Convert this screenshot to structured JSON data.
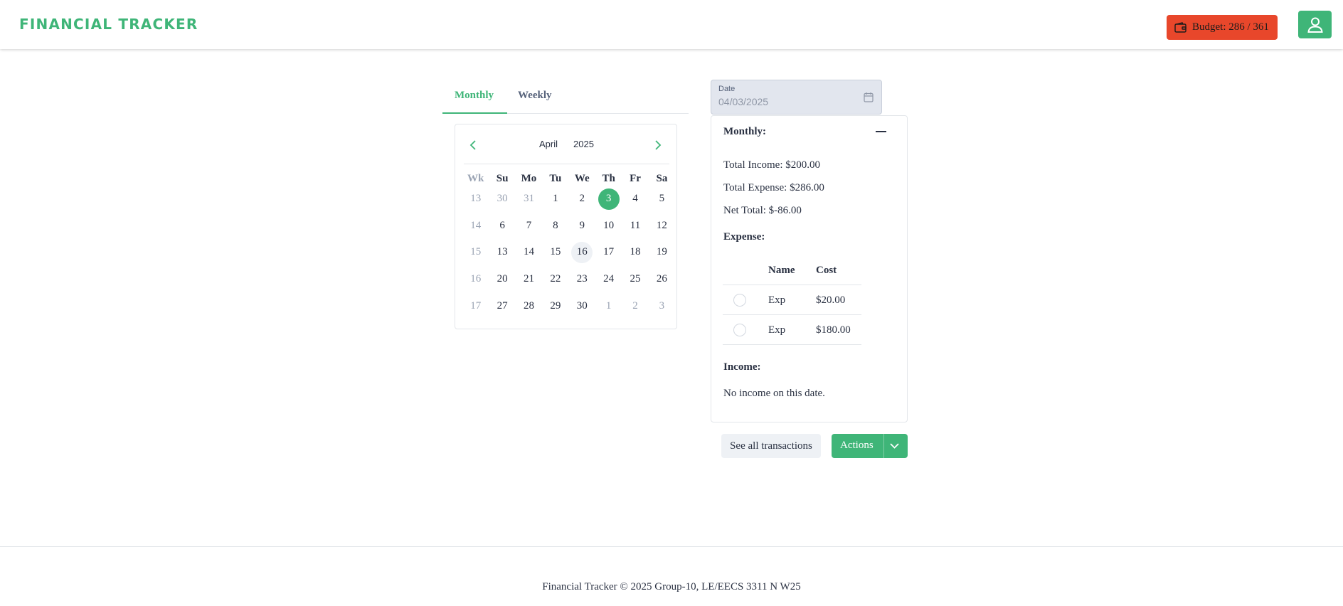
{
  "header": {
    "logo": "FINANCIAL TRACKER",
    "budget_label": "Budget: 286 / 361",
    "budget_icon": "wallet-icon",
    "profile_icon": "user-icon",
    "colors": {
      "brand": "#3fb578",
      "budget_bg": "#e8472b"
    }
  },
  "tabs": [
    {
      "label": "Monthly",
      "active": true
    },
    {
      "label": "Weekly",
      "active": false
    }
  ],
  "calendar": {
    "month": "April",
    "year": "2025",
    "headers": [
      "Wk",
      "Su",
      "Mo",
      "Tu",
      "We",
      "Th",
      "Fr",
      "Sa"
    ],
    "weeks": [
      {
        "wk": "13",
        "days": [
          "30",
          "31",
          "1",
          "2",
          "3",
          "4",
          "5"
        ]
      },
      {
        "wk": "14",
        "days": [
          "6",
          "7",
          "8",
          "9",
          "10",
          "11",
          "12"
        ]
      },
      {
        "wk": "15",
        "days": [
          "13",
          "14",
          "15",
          "16",
          "17",
          "18",
          "19"
        ]
      },
      {
        "wk": "16",
        "days": [
          "20",
          "21",
          "22",
          "23",
          "24",
          "25",
          "26"
        ]
      },
      {
        "wk": "17",
        "days": [
          "27",
          "28",
          "29",
          "30",
          "1",
          "2",
          "3"
        ]
      }
    ],
    "selected_day": "3"
  },
  "date_field": {
    "label": "Date",
    "value": "04/03/2025",
    "icon": "calendar-icon"
  },
  "summary": {
    "title": "Monthly:",
    "total_income": "Total Income: $200.00",
    "total_expense": "Total Expense: $286.00",
    "net_total": "Net Total: $-86.00",
    "expense_title": "Expense:",
    "expense_columns": {
      "name": "Name",
      "cost": "Cost"
    },
    "expenses": [
      {
        "name": "Exp",
        "cost": "$20.00"
      },
      {
        "name": "Exp",
        "cost": "$180.00"
      }
    ],
    "income_title": "Income:",
    "no_income": "No income on this date."
  },
  "buttons": {
    "see_all": "See all transactions",
    "actions": "Actions"
  },
  "footer": {
    "text": "Financial Tracker © 2025 Group-10, LE/EECS 3311 N W25"
  }
}
